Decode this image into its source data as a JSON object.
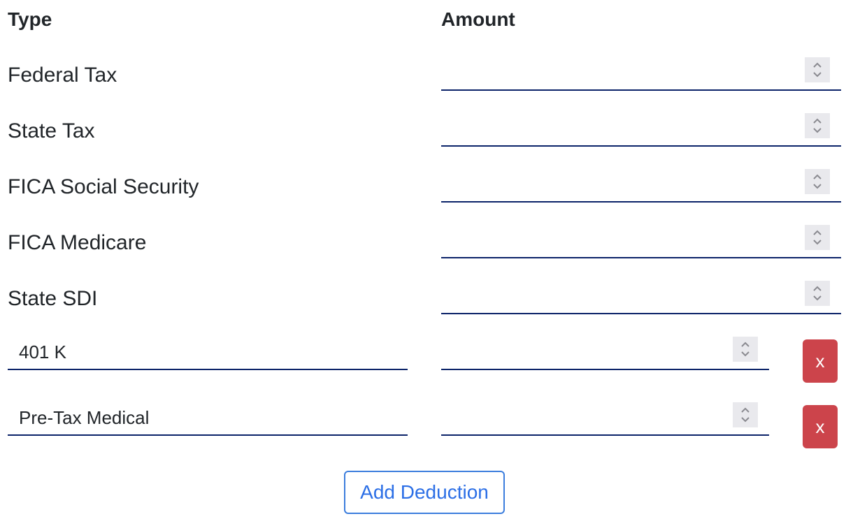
{
  "headers": {
    "type": "Type",
    "amount": "Amount"
  },
  "fixed_rows": [
    {
      "label": "Federal Tax",
      "amount": ""
    },
    {
      "label": "State Tax",
      "amount": ""
    },
    {
      "label": "FICA Social Security",
      "amount": ""
    },
    {
      "label": "FICA Medicare",
      "amount": ""
    },
    {
      "label": "State SDI",
      "amount": ""
    }
  ],
  "custom_rows": [
    {
      "type": "401 K",
      "amount": "",
      "remove_label": "x"
    },
    {
      "type": "Pre-Tax Medical",
      "amount": "",
      "remove_label": "x"
    }
  ],
  "add_button_label": "Add Deduction",
  "colors": {
    "underline": "#0b2369",
    "remove": "#cc444b",
    "accent": "#3b7ddd"
  }
}
